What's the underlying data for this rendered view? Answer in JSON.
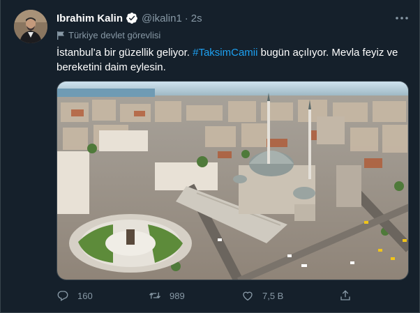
{
  "author": {
    "name": "Ibrahim Kalin",
    "handle": "@ikalin1",
    "separator": "·",
    "time": "2s",
    "account_label": "Türkiye devlet görevlisi"
  },
  "tweet": {
    "text_before": "İstanbul’a bir güzellik geliyor. ",
    "hashtag": "#TaksimCamii",
    "text_after": " bugün açılıyor. Mevla feyiz ve bereketini daim eylesin."
  },
  "media": {
    "description_icon": "photo"
  },
  "actions": {
    "replies": "160",
    "retweets": "989",
    "likes": "7,5 B"
  },
  "icons": {
    "verified": "verified-badge-icon",
    "more": "more-icon",
    "label": "flag-icon",
    "reply": "reply-icon",
    "retweet": "retweet-icon",
    "like": "heart-icon",
    "share": "share-icon"
  },
  "colors": {
    "background": "#15202b",
    "accent": "#1da1f2",
    "secondary_text": "#8899a6"
  }
}
